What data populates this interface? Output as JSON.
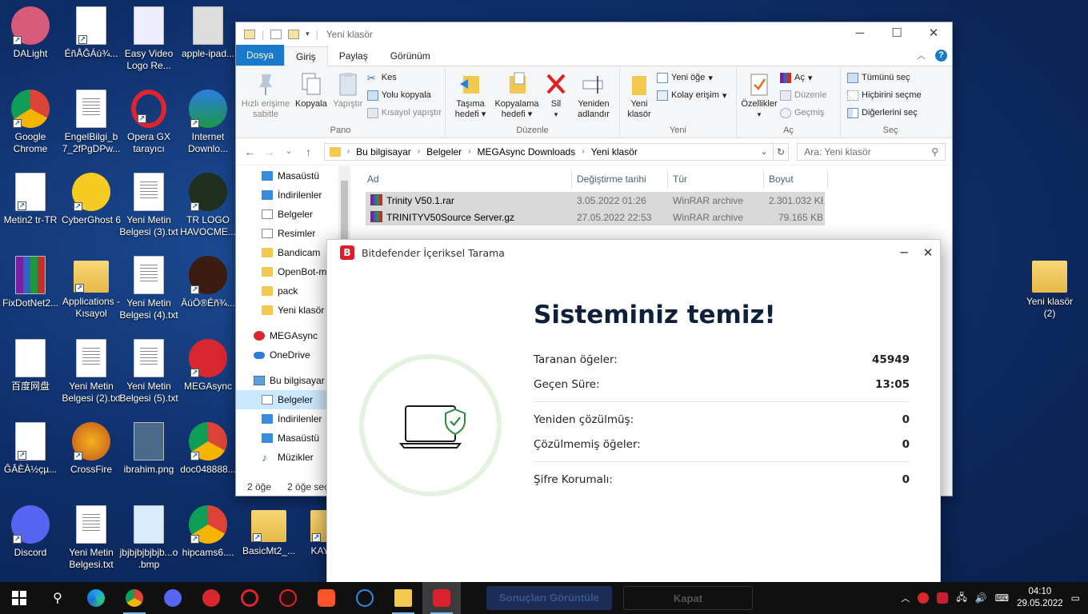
{
  "desktop": {
    "icons": [
      {
        "label": "DALight"
      },
      {
        "label": "ÉñÅĞÁú¾..."
      },
      {
        "label": "Easy Video Logo Re..."
      },
      {
        "label": "apple-ipad..."
      },
      {
        "label": "Google Chrome"
      },
      {
        "label": "EngelBilgi_b 7_2fPgDPw..."
      },
      {
        "label": "Opera GX tarayıcı"
      },
      {
        "label": "Internet Downlo..."
      },
      {
        "label": "Metin2 tr-TR"
      },
      {
        "label": "CyberGhost 6"
      },
      {
        "label": "Yeni Metin Belgesi (3).txt"
      },
      {
        "label": "TR LOGO HAVOCME..."
      },
      {
        "label": "FixDotNet2..."
      },
      {
        "label": "Applications - Kısayol"
      },
      {
        "label": "Yeni Metin Belgesi (4).txt"
      },
      {
        "label": "ÄúÖ®Éñ¾..."
      },
      {
        "label": "百度网盘"
      },
      {
        "label": "Yeni Metin Belgesi (2).txt"
      },
      {
        "label": "Yeni Metin Belgesi (5).txt"
      },
      {
        "label": "MEGAsync"
      },
      {
        "label": "ĜÂÈÀ½çµ..."
      },
      {
        "label": "CrossFire"
      },
      {
        "label": "ibrahim.png"
      },
      {
        "label": "doc048888..."
      },
      {
        "label": "Discord"
      },
      {
        "label": "Yeni Metin Belgesi.txt"
      },
      {
        "label": "jbjbjbjbjbjb...o .bmp"
      },
      {
        "label": "hipcams6...."
      },
      {
        "label": "BasicMt2_..."
      },
      {
        "label": "KAYM..."
      },
      {
        "label": "Yeni klasör (2)"
      }
    ]
  },
  "explorer": {
    "title": "Yeni klasör",
    "tabs": {
      "file": "Dosya",
      "home": "Giriş",
      "share": "Paylaş",
      "view": "Görünüm"
    },
    "ribbon": {
      "pin_quick": "Hızlı erişime sabitle",
      "copy": "Kopyala",
      "paste": "Yapıştır",
      "cut": "Kes",
      "copy_path": "Yolu kopyala",
      "paste_shortcut": "Kısayol yapıştır",
      "group_clipboard": "Pano",
      "move_to": "Taşıma hedefi",
      "copy_to": "Kopyalama hedefi",
      "delete": "Sil",
      "rename": "Yeniden adlandır",
      "group_organize": "Düzenle",
      "new_folder": "Yeni klasör",
      "new_item": "Yeni öğe",
      "easy_access": "Kolay erişim",
      "group_new": "Yeni",
      "properties": "Özellikler",
      "open": "Aç",
      "edit": "Düzenle",
      "history": "Geçmiş",
      "group_open": "Aç",
      "select_all": "Tümünü seç",
      "select_none": "Hiçbirini seçme",
      "invert_selection": "Diğerlerini seç",
      "group_select": "Seç"
    },
    "address": {
      "crumbs": [
        "Bu bilgisayar",
        "Belgeler",
        "MEGAsync Downloads",
        "Yeni klasör"
      ]
    },
    "search_placeholder": "Ara: Yeni klasör",
    "nav": [
      {
        "label": "Masaüstü",
        "icon": "blue"
      },
      {
        "label": "İndirilenler",
        "icon": "blue"
      },
      {
        "label": "Belgeler",
        "icon": "doc"
      },
      {
        "label": "Resimler",
        "icon": "doc"
      },
      {
        "label": "Bandicam",
        "icon": "folder"
      },
      {
        "label": "OpenBot-m",
        "icon": "folder"
      },
      {
        "label": "pack",
        "icon": "folder"
      },
      {
        "label": "Yeni klasör",
        "icon": "folder"
      },
      {
        "label": "MEGAsync",
        "icon": "mega"
      },
      {
        "label": "OneDrive",
        "icon": "cloud"
      },
      {
        "label": "Bu bilgisayar",
        "icon": "pc"
      },
      {
        "label": "Belgeler",
        "icon": "doc"
      },
      {
        "label": "İndirilenler",
        "icon": "blue"
      },
      {
        "label": "Masaüstü",
        "icon": "blue"
      },
      {
        "label": "Müzikler",
        "icon": "music"
      }
    ],
    "columns": {
      "name": "Ad",
      "date": "Değiştirme tarihi",
      "type": "Tür",
      "size": "Boyut"
    },
    "files": [
      {
        "name": "Trinity V50.1.rar",
        "date": "3.05.2022 01:26",
        "type": "WinRAR archive",
        "size": "2.301.032 KB"
      },
      {
        "name": "TRINITYV50Source Server.gz",
        "date": "27.05.2022 22:53",
        "type": "WinRAR archive",
        "size": "79.165 KB"
      }
    ],
    "status": {
      "count": "2 öğe",
      "selected": "2 öğe seç"
    }
  },
  "bitdefender": {
    "title": "Bitdefender İçeriksel Tarama",
    "headline": "Sisteminiz temiz!",
    "stats": [
      {
        "label": "Taranan öğeler:",
        "value": "45949"
      },
      {
        "label": "Geçen Süre:",
        "value": "13:05"
      },
      {
        "label": "Yeniden çözülmüş:",
        "value": "0"
      },
      {
        "label": "Çözülmemiş öğeler:",
        "value": "0"
      },
      {
        "label": "Şifre Korumalı:",
        "value": "0"
      }
    ],
    "btn_results": "Sonuçları Görüntüle",
    "btn_close": "Kapat",
    "accent": "#d9202b",
    "ok_color": "#2c8a3a"
  },
  "taskbar": {
    "time": "04:10",
    "date": "29.05.2022"
  }
}
